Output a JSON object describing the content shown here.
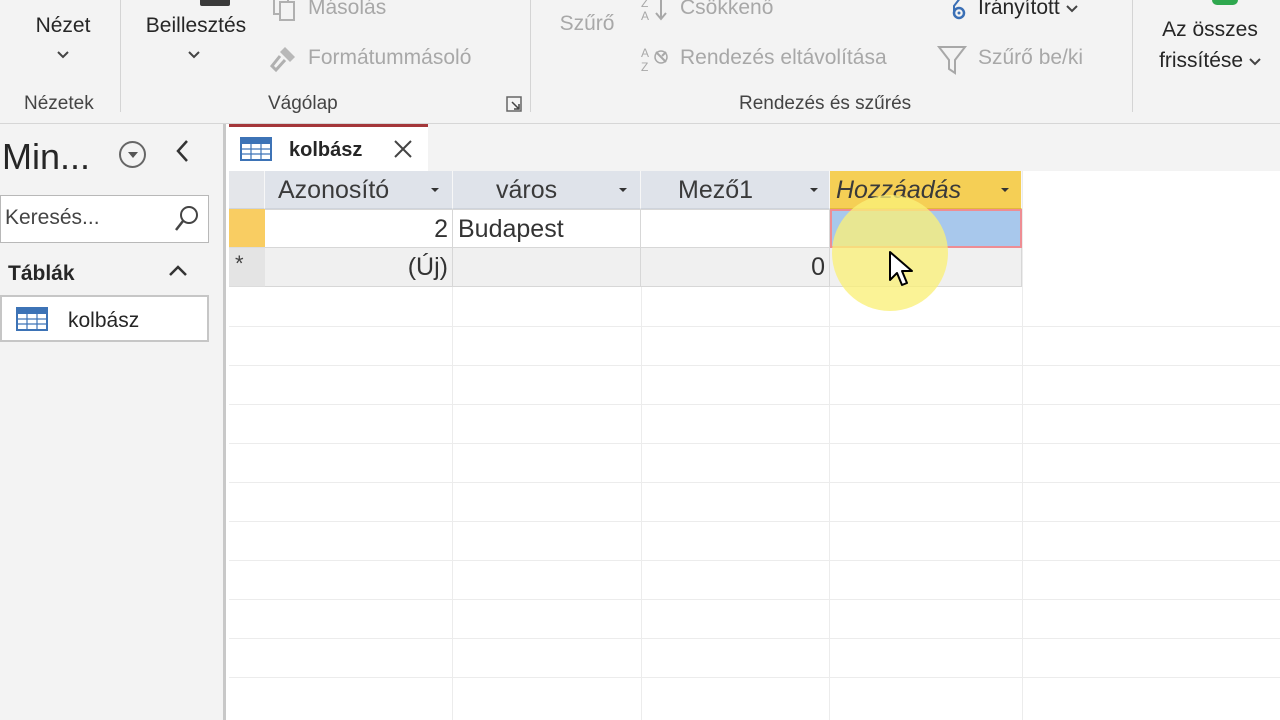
{
  "ribbon": {
    "groups": {
      "views": {
        "view_button": "Nézet",
        "label": "Nézetek"
      },
      "clipboard": {
        "paste_button": "Beillesztés",
        "copy_button": "Másolás",
        "format_painter_button": "Formátummásoló",
        "label": "Vágólap"
      },
      "sort_filter": {
        "filter_button": "Szűrő",
        "descending_button": "Csökkenő",
        "remove_sort_button": "Rendezés eltávolítása",
        "advanced_button": "Irányított",
        "toggle_filter_button": "Szűrő be/ki",
        "label": "Rendezés és szűrés"
      },
      "records": {
        "refresh_all_line1": "Az összes",
        "refresh_all_line2": "frissítése"
      }
    }
  },
  "nav_pane": {
    "title": "Min...",
    "search_placeholder": "Keresés...",
    "section_label": "Táblák",
    "items": [
      {
        "label": "kolbász",
        "icon": "table-icon"
      }
    ]
  },
  "document": {
    "tab_label": "kolbász",
    "tab_icon": "table-icon",
    "columns": [
      {
        "label": "Azonosító"
      },
      {
        "label": "város"
      },
      {
        "label": "Mező1"
      },
      {
        "label": "Hozzáadás"
      }
    ],
    "rows": [
      {
        "id": "2",
        "varos": "Budapest",
        "mezo1": "",
        "hozzaadas": ""
      },
      {
        "id": "(Új)",
        "varos": "",
        "mezo1": "0",
        "hozzaadas": "",
        "selector": "*"
      }
    ]
  },
  "colors": {
    "active_tab_accent": "#a4373a",
    "add_column_header": "#f5cf55",
    "selected_cell": "#a8c8ec",
    "row_selector_active": "#f9cd62",
    "cursor_highlight": "#f7ee78"
  }
}
